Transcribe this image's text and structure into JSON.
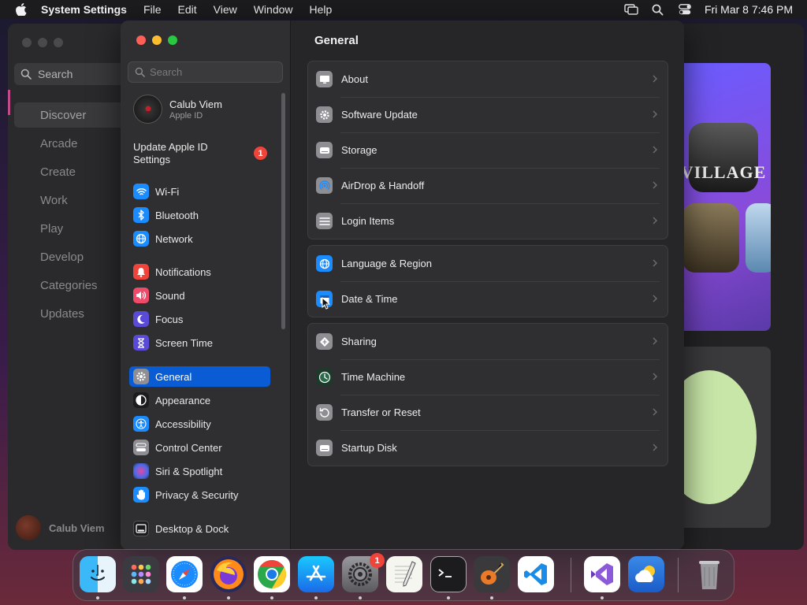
{
  "menubar": {
    "app_name": "System Settings",
    "menus": [
      "File",
      "Edit",
      "View",
      "Window",
      "Help"
    ],
    "datetime": "Fri Mar 8  7:46 PM"
  },
  "background_app": {
    "search_label": "Search",
    "nav": [
      "Discover",
      "Arcade",
      "Create",
      "Work",
      "Play",
      "Develop",
      "Categories",
      "Updates"
    ],
    "selected_nav": "Discover",
    "user_name": "Calub Viem",
    "tile_text": "VILLAGE"
  },
  "settings": {
    "search_placeholder": "Search",
    "account": {
      "name": "Calub Viem",
      "subtitle": "Apple ID"
    },
    "update_notice": {
      "label": "Update Apple ID Settings",
      "badge": "1"
    },
    "sidebar_items": [
      {
        "label": "Wi-Fi",
        "icon": "wifi-icon",
        "color": "#1a8cff"
      },
      {
        "label": "Bluetooth",
        "icon": "bluetooth-icon",
        "color": "#1a8cff"
      },
      {
        "label": "Network",
        "icon": "globe-icon",
        "color": "#1a8cff"
      },
      {
        "label": "Notifications",
        "icon": "bell-icon",
        "color": "#f0443a"
      },
      {
        "label": "Sound",
        "icon": "speaker-icon",
        "color": "#f04a6a"
      },
      {
        "label": "Focus",
        "icon": "moon-icon",
        "color": "#5a4ad8"
      },
      {
        "label": "Screen Time",
        "icon": "hourglass-icon",
        "color": "#5a4ad8"
      },
      {
        "label": "General",
        "icon": "gear-icon",
        "color": "#8e8e93"
      },
      {
        "label": "Appearance",
        "icon": "appearance-icon",
        "color": "#1c1c1e"
      },
      {
        "label": "Accessibility",
        "icon": "accessibility-icon",
        "color": "#1a8cff"
      },
      {
        "label": "Control Center",
        "icon": "control-center-icon",
        "color": "#8e8e93"
      },
      {
        "label": "Siri & Spotlight",
        "icon": "siri-icon",
        "color": "#7a4ad8"
      },
      {
        "label": "Privacy & Security",
        "icon": "hand-icon",
        "color": "#1a8cff"
      },
      {
        "label": "Desktop & Dock",
        "icon": "dock-icon",
        "color": "#1c1c1e"
      }
    ],
    "selected_item": "General",
    "content_title": "General",
    "groups": [
      [
        {
          "label": "About",
          "icon": "display-icon"
        },
        {
          "label": "Software Update",
          "icon": "gear-badge-icon"
        },
        {
          "label": "Storage",
          "icon": "drive-icon"
        },
        {
          "label": "AirDrop & Handoff",
          "icon": "airdrop-icon"
        },
        {
          "label": "Login Items",
          "icon": "list-icon"
        }
      ],
      [
        {
          "label": "Language & Region",
          "icon": "globe-icon"
        },
        {
          "label": "Date & Time",
          "icon": "calendar-icon"
        }
      ],
      [
        {
          "label": "Sharing",
          "icon": "sharing-icon"
        },
        {
          "label": "Time Machine",
          "icon": "time-machine-icon"
        },
        {
          "label": "Transfer or Reset",
          "icon": "reset-icon"
        },
        {
          "label": "Startup Disk",
          "icon": "disk-icon"
        }
      ]
    ]
  },
  "dock": {
    "apps": [
      "Finder",
      "Launchpad",
      "Safari",
      "Firefox",
      "Chrome",
      "App Store",
      "System Settings",
      "TextEdit",
      "Terminal",
      "GarageBand",
      "Visual Studio Code",
      "Visual Studio",
      "Weather",
      "Trash"
    ],
    "settings_badge": "1"
  }
}
